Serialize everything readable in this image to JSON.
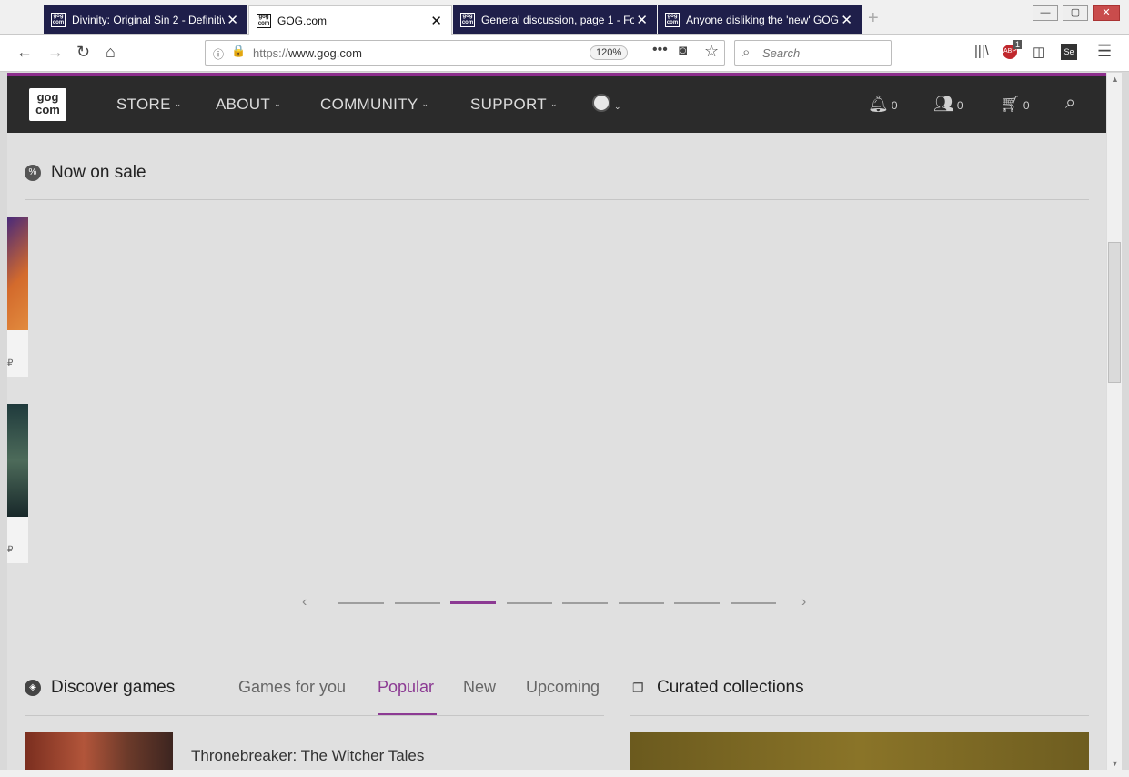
{
  "tabs": [
    {
      "title": "Divinity: Original Sin 2 - Definitive",
      "favicon": "gog"
    },
    {
      "title": "GOG.com",
      "favicon": "gog"
    },
    {
      "title": "General discussion, page 1 - Fo",
      "favicon": "gog"
    },
    {
      "title": "Anyone disliking the 'new' GOG",
      "favicon": "gog"
    }
  ],
  "active_tab_index": 1,
  "address": {
    "protocol": "https://",
    "host": "www.gog.com",
    "zoom": "120%"
  },
  "search": {
    "placeholder": "Search"
  },
  "toolbar": {
    "adblock_count": "1"
  },
  "gog_nav": {
    "logo_line1": "gog",
    "logo_line2": "com",
    "menu": [
      "STORE",
      "ABOUT",
      "COMMUNITY",
      "SUPPORT"
    ],
    "notifications_count": "0",
    "friends_count": "0",
    "cart_count": "0"
  },
  "sale": {
    "title": "Now on sale",
    "card_symbol": "₽",
    "carousel_pages": 8,
    "active_page": 3
  },
  "discover": {
    "title": "Discover games",
    "tabs": [
      "Games for you",
      "Popular",
      "New",
      "Upcoming"
    ],
    "active_tab": "Popular",
    "first_game": "Thronebreaker: The Witcher Tales"
  },
  "curated": {
    "title": "Curated collections"
  },
  "colors": {
    "accent": "#8c3a93",
    "nav_bg": "#2b2b2b",
    "tab_dark": "#1f1f4a"
  }
}
